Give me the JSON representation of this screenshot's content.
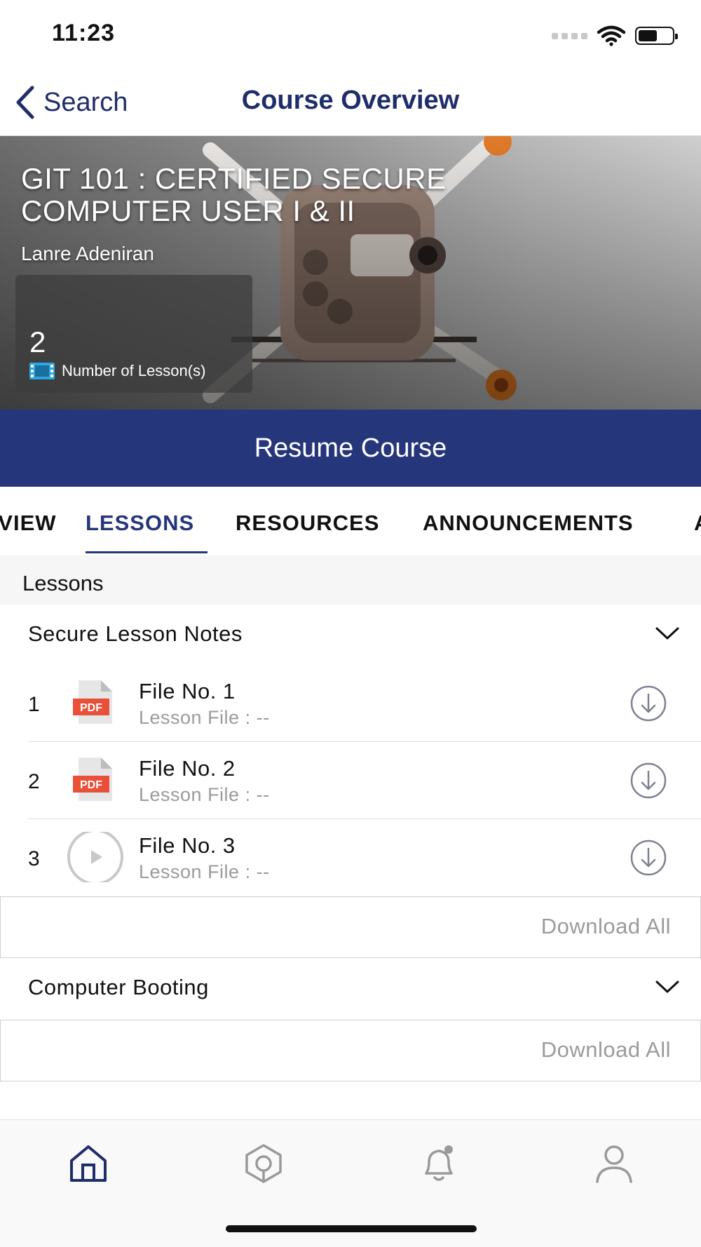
{
  "status_bar": {
    "time": "11:23"
  },
  "nav": {
    "back_label": "Search",
    "title": "Course Overview"
  },
  "hero": {
    "title_line1": "GIT 101 : CERTIFIED SECURE",
    "title_line2": "COMPUTER USER I & II",
    "author": "Lanre Adeniran",
    "lesson_count": "2",
    "lesson_count_label": "Number of Lesson(s)"
  },
  "resume_label": "Resume Course",
  "tabs": [
    {
      "label": "OVERVIEW",
      "active": false
    },
    {
      "label": "LESSONS",
      "active": true
    },
    {
      "label": "RESOURCES",
      "active": false
    },
    {
      "label": "ANNOUNCEMENTS",
      "active": false
    },
    {
      "label": "A",
      "active": false
    }
  ],
  "section_header": "Lessons",
  "groups": [
    {
      "title": "Secure Lesson Notes",
      "items": [
        {
          "num": "1",
          "icon": "pdf-file-icon",
          "pdf_label": "PDF",
          "title": "File No. 1",
          "sub": "Lesson File : --"
        },
        {
          "num": "2",
          "icon": "pdf-file-icon",
          "pdf_label": "PDF",
          "title": "File No. 2",
          "sub": "Lesson File : --"
        },
        {
          "num": "3",
          "icon": "video-play-icon",
          "title": "File No. 3",
          "sub": "Lesson File : --"
        }
      ],
      "download_all": "Download All"
    },
    {
      "title": "Computer Booting",
      "items": [],
      "download_all": "Download All"
    }
  ],
  "bottom_nav": [
    {
      "icon": "home-icon",
      "active": true
    },
    {
      "icon": "explore-icon",
      "active": false
    },
    {
      "icon": "bell-icon",
      "active": false
    },
    {
      "icon": "profile-icon",
      "active": false
    }
  ],
  "colors": {
    "brand": "#25367a",
    "nav_text": "#1f2d6b",
    "muted": "#9b9b9b",
    "pdf_red": "#e8503a"
  }
}
